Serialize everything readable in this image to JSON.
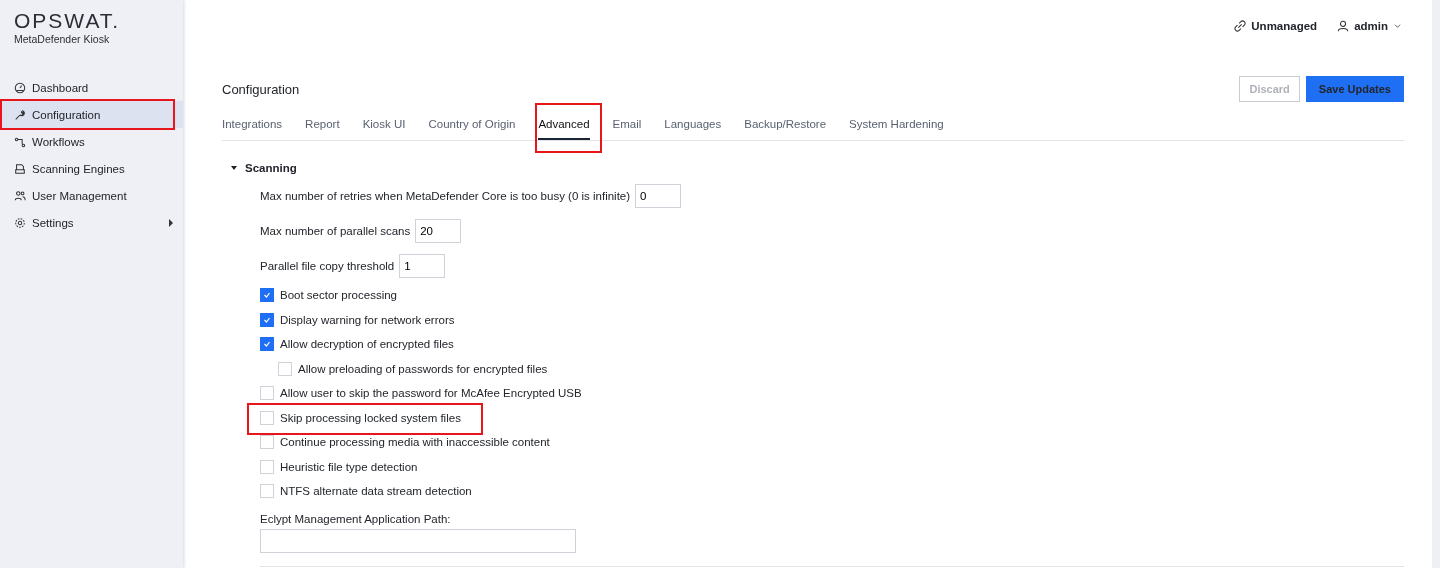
{
  "brand": {
    "logo": "OPSWAT.",
    "product": "MetaDefender Kiosk"
  },
  "sidebar": {
    "items": [
      {
        "label": "Dashboard",
        "selected": false,
        "highlighted": false,
        "submenu": false
      },
      {
        "label": "Configuration",
        "selected": true,
        "highlighted": true,
        "submenu": false
      },
      {
        "label": "Workflows",
        "selected": false,
        "highlighted": false,
        "submenu": false
      },
      {
        "label": "Scanning Engines",
        "selected": false,
        "highlighted": false,
        "submenu": false
      },
      {
        "label": "User Management",
        "selected": false,
        "highlighted": false,
        "submenu": false
      },
      {
        "label": "Settings",
        "selected": false,
        "highlighted": false,
        "submenu": true
      }
    ]
  },
  "header": {
    "status": "Unmanaged",
    "user": "admin"
  },
  "page": {
    "title": "Configuration",
    "buttons": [
      {
        "label": "Discard",
        "kind": "secondary",
        "disabled": true
      },
      {
        "label": "Save Updates",
        "kind": "primary",
        "disabled": false
      }
    ]
  },
  "tabs": [
    {
      "label": "Integrations",
      "selected": false,
      "highlighted": false
    },
    {
      "label": "Report",
      "selected": false,
      "highlighted": false
    },
    {
      "label": "Kiosk UI",
      "selected": false,
      "highlighted": false
    },
    {
      "label": "Country of Origin",
      "selected": false,
      "highlighted": false
    },
    {
      "label": "Advanced",
      "selected": true,
      "highlighted": true
    },
    {
      "label": "Email",
      "selected": false,
      "highlighted": false
    },
    {
      "label": "Languages",
      "selected": false,
      "highlighted": false
    },
    {
      "label": "Backup/Restore",
      "selected": false,
      "highlighted": false
    },
    {
      "label": "System Hardening",
      "selected": false,
      "highlighted": false
    }
  ],
  "section": {
    "title": "Scanning",
    "expanded": true,
    "settings": [
      {
        "kind": "number",
        "label": "Max number of retries when MetaDefender Core is too busy (0 is infinite)",
        "value": "0"
      },
      {
        "kind": "number",
        "label": "Max number of parallel scans",
        "value": "20"
      },
      {
        "kind": "number",
        "label": "Parallel file copy threshold",
        "value": "1"
      },
      {
        "kind": "checkbox",
        "label": "Boot sector processing",
        "checked": true,
        "highlighted": false
      },
      {
        "kind": "checkbox",
        "label": "Display warning for network errors",
        "checked": true,
        "highlighted": false
      },
      {
        "kind": "checkbox",
        "label": "Allow decryption of encrypted files",
        "checked": true,
        "highlighted": false,
        "children": [
          {
            "kind": "checkbox",
            "label": "Allow preloading of passwords for encrypted files",
            "checked": false,
            "highlighted": false
          }
        ]
      },
      {
        "kind": "checkbox",
        "label": "Allow user to skip the password for McAfee Encrypted USB",
        "checked": false,
        "highlighted": false
      },
      {
        "kind": "checkbox",
        "label": "Skip processing locked system files",
        "checked": false,
        "highlighted": true
      },
      {
        "kind": "checkbox",
        "label": "Continue processing media with inaccessible content",
        "checked": false,
        "highlighted": false
      },
      {
        "kind": "checkbox",
        "label": "Heuristic file type detection",
        "checked": false,
        "highlighted": false
      },
      {
        "kind": "checkbox",
        "label": "NTFS alternate data stream detection",
        "checked": false,
        "highlighted": false
      },
      {
        "kind": "text",
        "label": "Eclypt Management Application Path:"
      }
    ]
  }
}
